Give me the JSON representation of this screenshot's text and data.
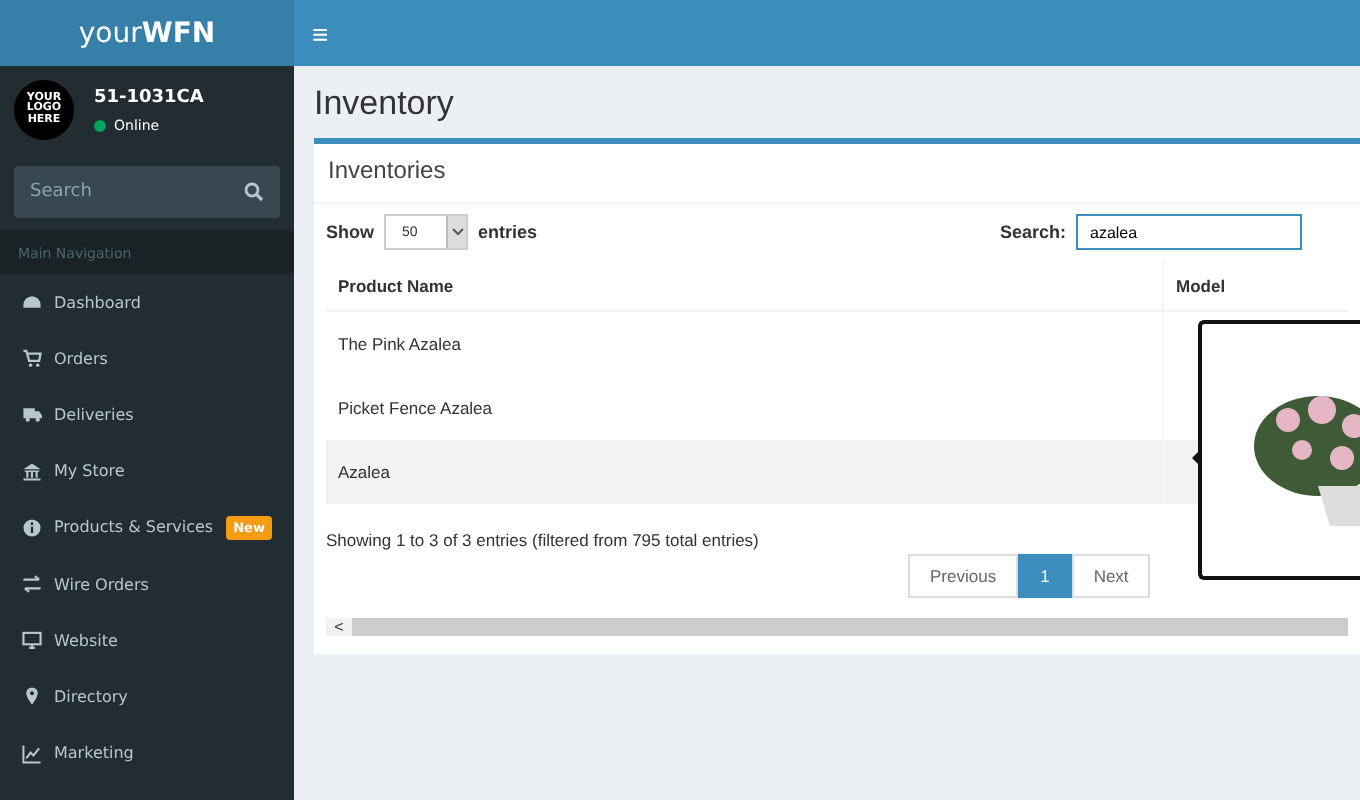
{
  "brand": "your**WFN**",
  "user": {
    "logo_text": "YOUR LOGO HERE",
    "name": "51-1031CA",
    "status": "Online",
    "online": true
  },
  "sidebar_search": {
    "placeholder": "Search"
  },
  "nav_header": "Main Navigation",
  "nav": [
    {
      "label": "Dashboard"
    },
    {
      "label": "Orders"
    },
    {
      "label": "Deliveries"
    },
    {
      "label": "My Store"
    },
    {
      "label": "Products & Services",
      "badge": "New"
    },
    {
      "label": "Wire Orders"
    },
    {
      "label": "Website"
    },
    {
      "label": "Directory"
    },
    {
      "label": "Marketing"
    }
  ],
  "topbar": {
    "menu_glyph": "≡"
  },
  "page_title": "Inventory",
  "box_title": "Inventories",
  "length": {
    "show": "Show",
    "value": "50",
    "entries": "entries"
  },
  "filter": {
    "label": "Search:",
    "value": "azalea"
  },
  "table": {
    "columns": [
      "Product Name",
      "Model"
    ],
    "rows": [
      {
        "cells": [
          "The Pink Azalea"
        ],
        "highlighted": false
      },
      {
        "cells": [
          "Picket Fence Azalea"
        ],
        "highlighted": false
      },
      {
        "cells": [
          "Azalea"
        ],
        "highlighted": true
      }
    ]
  },
  "info": "Showing 1 to 3 of 3 entries (filtered from 795 total entries)",
  "pagination": [
    {
      "label": "Previous",
      "selected": false
    },
    {
      "label": "1",
      "selected": true
    },
    {
      "label": "Next",
      "selected": false
    }
  ],
  "scrollbar": {
    "arrow": "<"
  }
}
